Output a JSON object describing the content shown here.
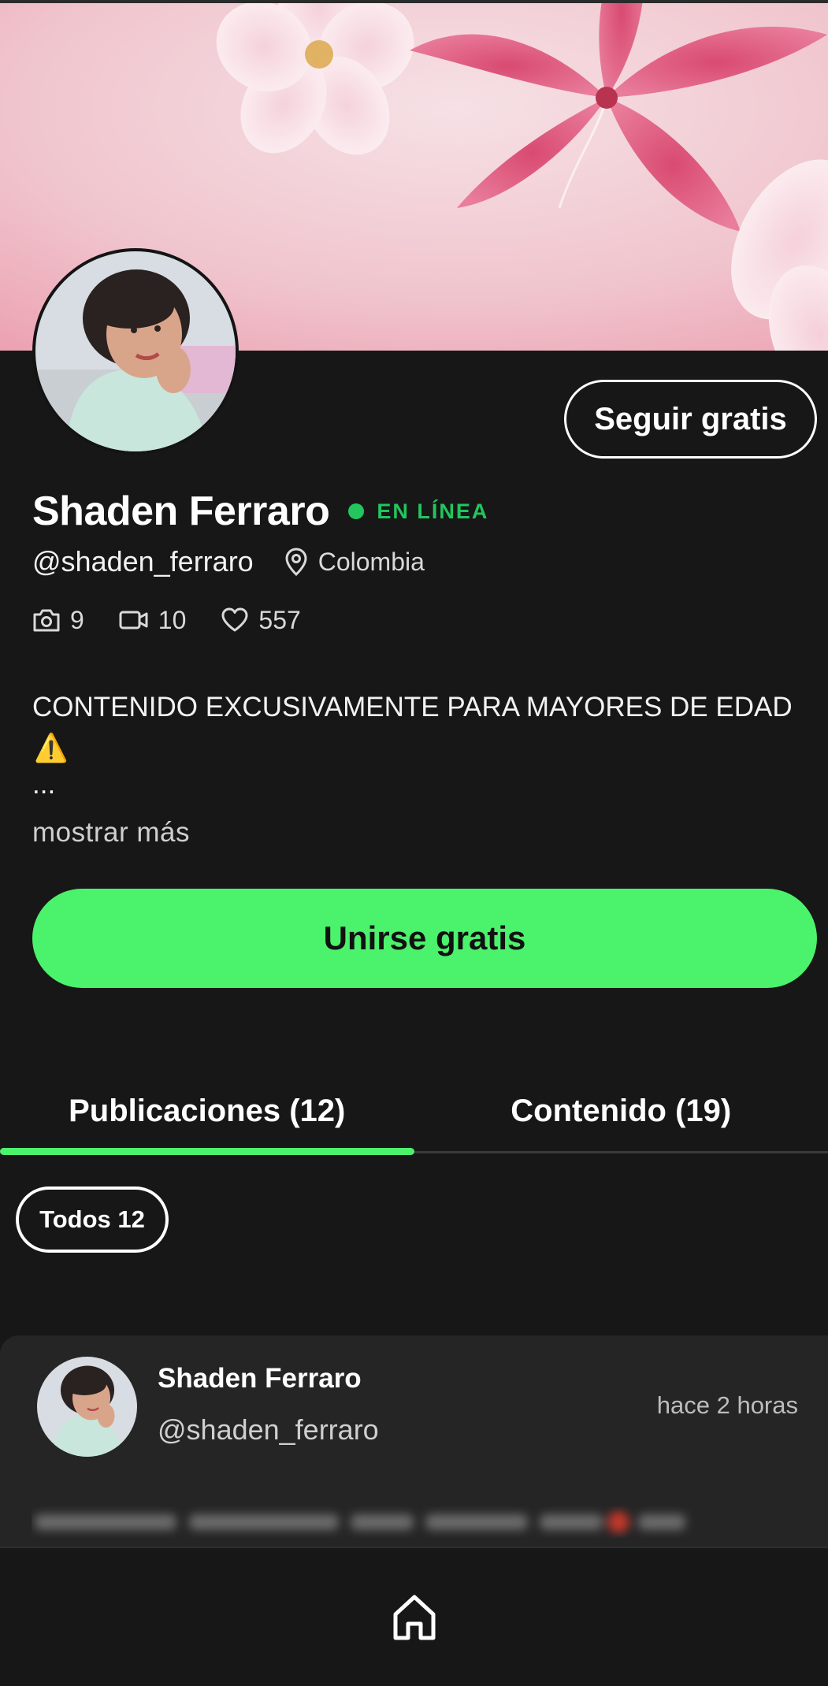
{
  "profile": {
    "display_name": "Shaden Ferraro",
    "status": "EN LÍNEA",
    "handle": "@shaden_ferraro",
    "location": "Colombia",
    "follow_label": "Seguir gratis",
    "stats": {
      "photos": "9",
      "videos": "10",
      "likes": "557"
    },
    "bio_line": "CONTENIDO EXCUSIVAMENTE PARA MAYORES DE EDAD",
    "bio_emoji": "⚠️",
    "bio_ellipsis": "...",
    "show_more": "mostrar más",
    "join_label": "Unirse gratis"
  },
  "tabs": [
    {
      "label": "Publicaciones (12)",
      "active": true
    },
    {
      "label": "Contenido (19)",
      "active": false
    }
  ],
  "filter": {
    "chip_label": "Todos 12"
  },
  "post": {
    "author": "Shaden Ferraro",
    "handle": "@shaden_ferraro",
    "time": "hace 2 horas"
  },
  "colors": {
    "accent": "#4bf26b",
    "online": "#22c55e",
    "background": "#171717",
    "card": "#252526"
  },
  "icons": {
    "photos": "camera-icon",
    "videos": "video-camera-icon",
    "likes": "heart-icon",
    "location": "map-pin-icon",
    "nav_home": "home-icon"
  }
}
